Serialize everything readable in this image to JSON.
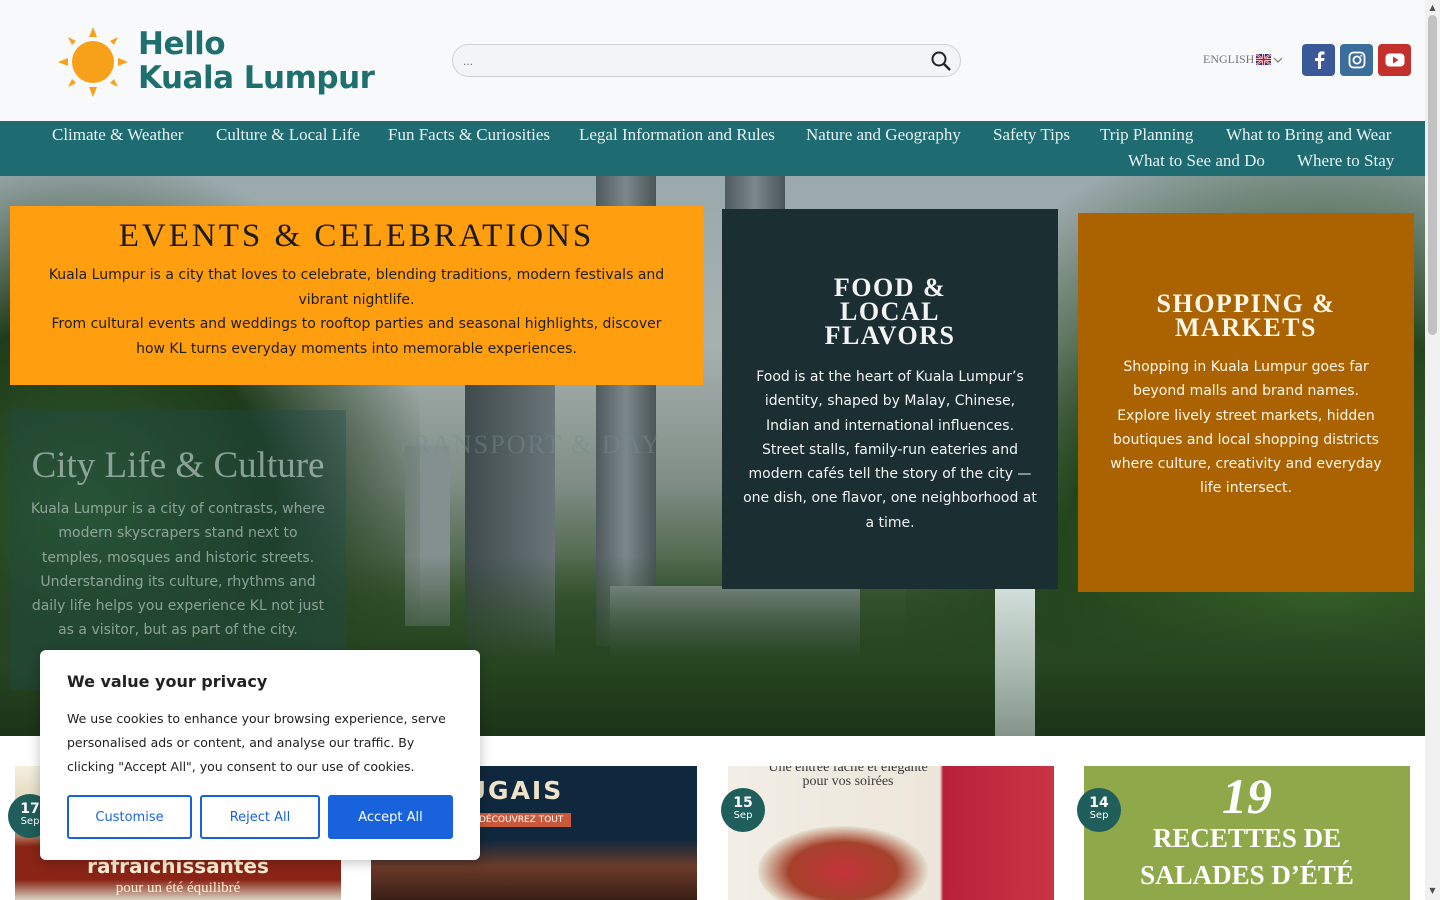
{
  "header": {
    "logo_line1": "Hello",
    "logo_line2": "Kuala Lumpur",
    "search_placeholder": "...",
    "language": "ENGLISH",
    "socials": [
      "facebook-icon",
      "instagram-icon",
      "youtube-icon"
    ]
  },
  "nav": {
    "items": [
      "Climate & Weather",
      "Culture & Local Life",
      "Fun Facts & Curiosities",
      "Legal Information and Rules",
      "Nature and Geography",
      "Safety Tips",
      "Trip Planning",
      "What to Bring and Wear",
      "What to See and Do",
      "Where to Stay"
    ]
  },
  "hero": {
    "events": {
      "title": "EVENTS & CELEBRATIONS",
      "p1": "Kuala Lumpur is a city that loves to celebrate, blending traditions, modern festivals and vibrant nightlife.",
      "p2": "From cultural events and weddings to rooftop parties and seasonal highlights, discover how KL turns everyday moments into memorable experiences."
    },
    "food": {
      "title": "FOOD & LOCAL FLAVORS",
      "p1": "Food is at the heart of Kuala Lumpur’s identity, shaped by Malay, Chinese, Indian and international influences.",
      "p2": "Street stalls, family-run eateries and modern cafés tell the story of the city — one dish, one flavor, one neighborhood at a time."
    },
    "shopping": {
      "title": "SHOPPING & MARKETS",
      "p1": "Shopping in Kuala Lumpur goes far beyond malls and brand names.",
      "p2": "Explore lively street markets, hidden boutiques and local shopping districts where culture, creativity and everyday life intersect."
    },
    "city": {
      "title": "City Life & Culture",
      "p1": "Kuala Lumpur is a city of contrasts, where modern skyscrapers stand next to temples, mosques and historic streets.",
      "p2": "Understanding its culture, rhythms and daily life helps you experience KL not just as a visitor, but as part of the city."
    },
    "ghost_title": "TRANSPORT & DAY"
  },
  "posts": [
    {
      "day": "17",
      "month": "Sep",
      "image_text_1": "rafraîchissantes",
      "image_text_2": "pour un été équilibré"
    },
    {
      "day": "",
      "month": "",
      "image_text_1": "PORTUGAIS",
      "image_text_2": "DÉCOUVREZ TOUT"
    },
    {
      "day": "15",
      "month": "Sep",
      "image_text_1": "Une entrée facile et élégante",
      "image_text_2": "pour vos soirées"
    },
    {
      "day": "14",
      "month": "Sep",
      "image_text_1": "19",
      "image_text_2": "RECETTES DE SALADES D’ÉTÉ"
    }
  ],
  "cookie": {
    "title": "We value your privacy",
    "text": "We use cookies to enhance your browsing experience, serve personalised ads or content, and analyse our traffic. By clicking \"Accept All\", you consent to our use of cookies.",
    "customise": "Customise",
    "reject": "Reject All",
    "accept": "Accept All"
  },
  "colors": {
    "brand_teal": "#1f6b72",
    "events_orange": "#ff9e0e",
    "food_dark": "#1b2f33",
    "shop_brown": "#aa6300",
    "cookie_blue": "#1863dc"
  }
}
